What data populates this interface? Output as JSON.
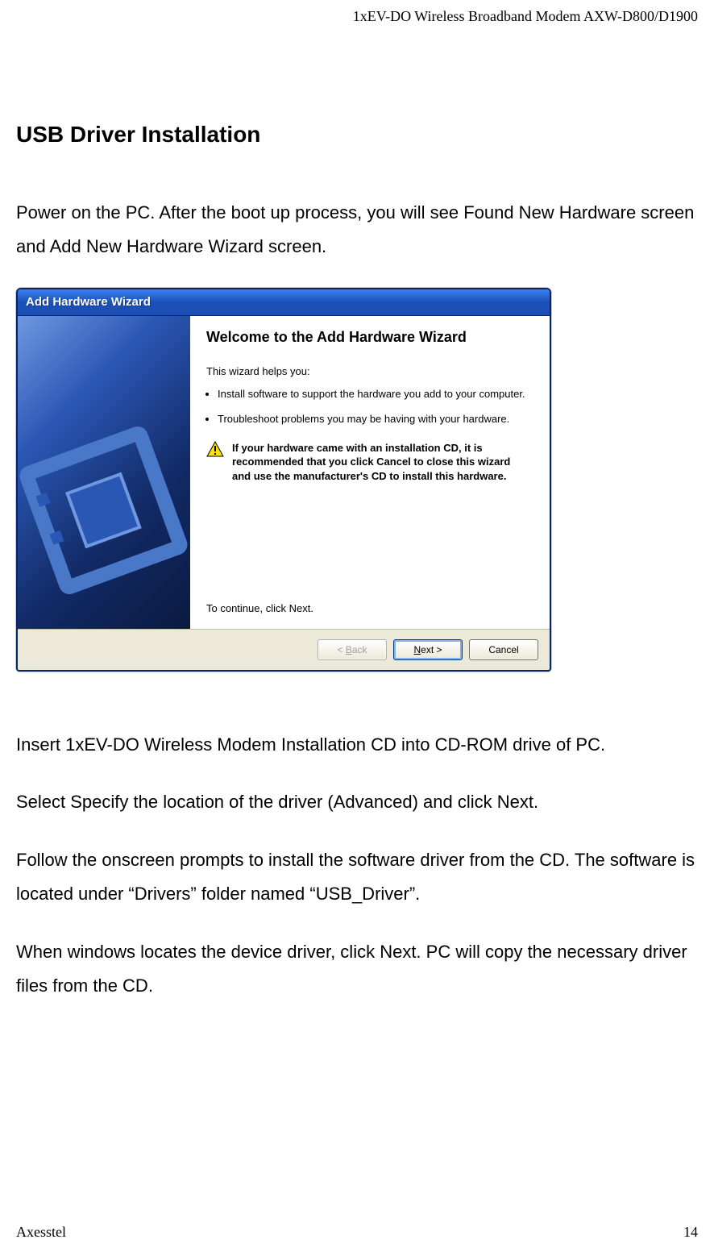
{
  "doc_header": "1xEV-DO Wireless Broadband Modem AXW-D800/D1900",
  "section_title": "USB Driver Installation",
  "intro_text": "Power on the PC. After the boot up process, you will see Found New Hardware screen and Add New Hardware Wizard screen.",
  "wizard": {
    "title": "Add Hardware Wizard",
    "heading": "Welcome to the Add Hardware Wizard",
    "help_label": "This wizard helps you:",
    "bullets": [
      "Install software to support the hardware you add to your computer.",
      "Troubleshoot problems you may be having with your hardware."
    ],
    "warning": "If your hardware came with an installation CD, it is recommended that you click Cancel to close this wizard and use the manufacturer's CD to install this hardware.",
    "continue_text": "To continue, click Next.",
    "buttons": {
      "back_prefix": "< ",
      "back_u": "B",
      "back_rest": "ack",
      "next_u": "N",
      "next_rest": "ext >",
      "cancel": "Cancel"
    }
  },
  "p2": "Insert 1xEV-DO Wireless Modem Installation CD into CD-ROM drive of PC.",
  "p3": "Select Specify the location of the driver (Advanced) and click Next.",
  "p4": "Follow the onscreen prompts to install the software driver from the CD. The software is located under “Drivers” folder named “USB_Driver”.",
  "p5": "When windows locates the device driver, click Next. PC will copy the necessary driver files from the CD.",
  "footer": {
    "left": "Axesstel",
    "right": "14"
  }
}
